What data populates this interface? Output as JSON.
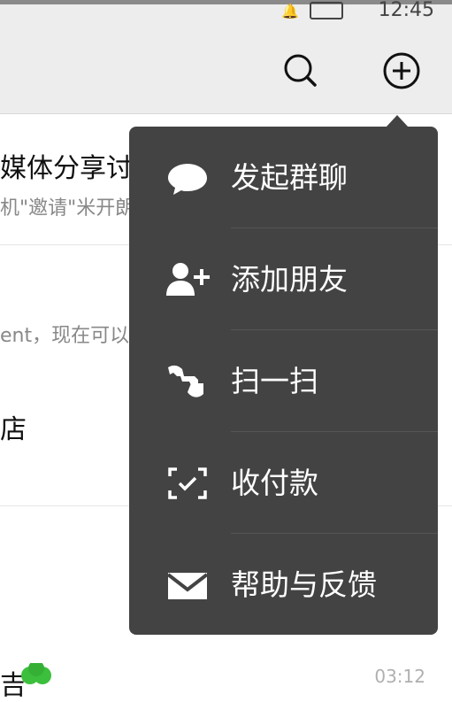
{
  "status_bar": {
    "time": "12:45"
  },
  "header": {
    "search_icon": "search-icon",
    "add_icon": "plus-circle-icon"
  },
  "chats": [
    {
      "title": "媒体分享讨",
      "subtitle": "机\"邀请\"米开朗",
      "time": ""
    },
    {
      "title": "",
      "subtitle": "ent，现在可以",
      "time": ""
    },
    {
      "title": "店",
      "subtitle": "",
      "time": ""
    },
    {
      "title": "",
      "subtitle": "",
      "time": ""
    },
    {
      "title": "吉",
      "subtitle": "",
      "time": "03:12"
    }
  ],
  "menu": {
    "items": [
      {
        "label": "发起群聊",
        "icon": "chat-bubble-icon"
      },
      {
        "label": "添加朋友",
        "icon": "add-friend-icon"
      },
      {
        "label": "扫一扫",
        "icon": "scan-icon"
      },
      {
        "label": "收付款",
        "icon": "payment-scan-icon"
      },
      {
        "label": "帮助与反馈",
        "icon": "envelope-icon"
      }
    ]
  },
  "colors": {
    "menu_bg": "#434343",
    "header_bg": "#ededed"
  }
}
